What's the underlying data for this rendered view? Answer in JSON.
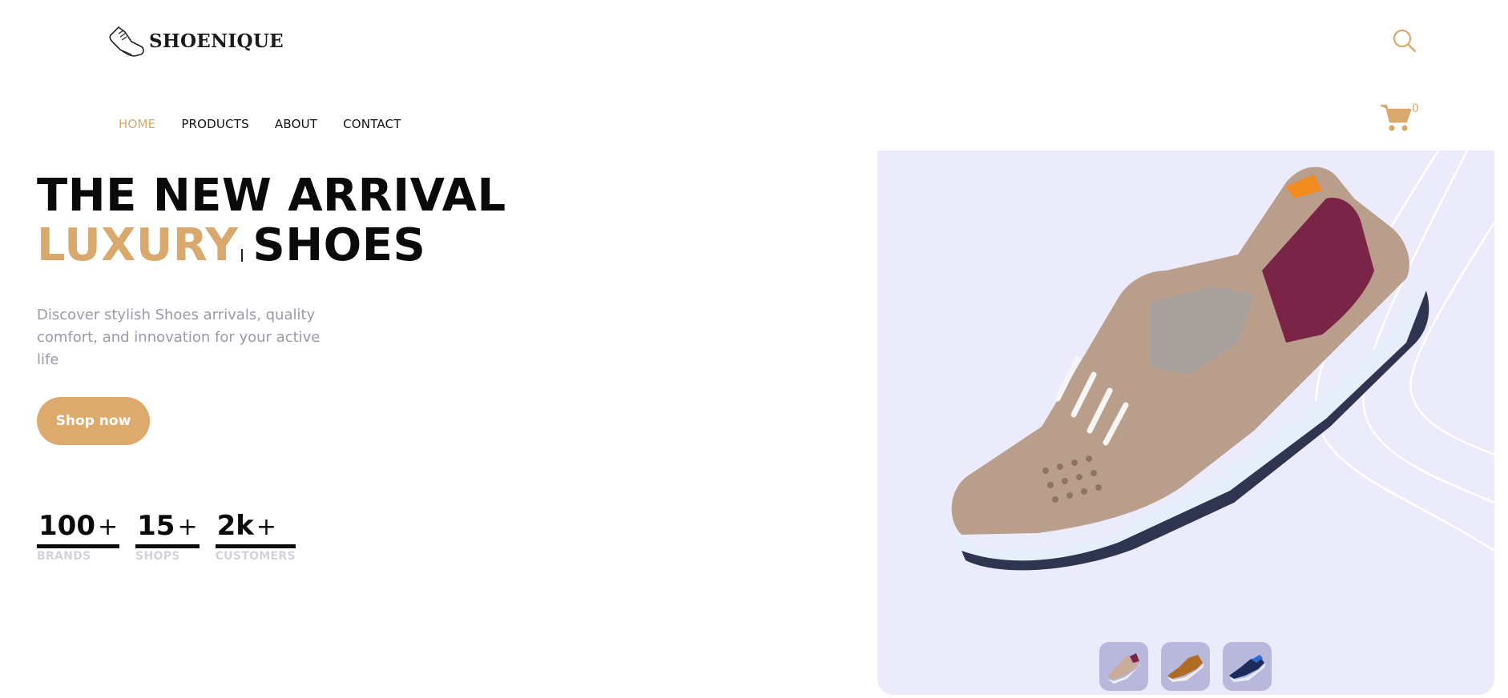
{
  "brand": {
    "name": "SHOENIQUE",
    "logo_icon": "sneaker-outline-icon"
  },
  "header": {
    "search_icon": "search-icon",
    "cart_icon": "cart-icon",
    "cart_count": "0"
  },
  "nav": {
    "items": [
      {
        "label": "HOME",
        "active": true
      },
      {
        "label": "PRODUCTS",
        "active": false
      },
      {
        "label": "ABOUT",
        "active": false
      },
      {
        "label": "CONTACT",
        "active": false
      }
    ]
  },
  "hero": {
    "title_line1": "THE NEW ARRIVAL",
    "title_accent": "LUXURY",
    "title_rest": "SHOES",
    "subtitle": "Discover stylish Shoes arrivals, quality comfort, and innovation for your active life",
    "cta_label": "Shop now"
  },
  "stats": [
    {
      "value": "100",
      "suffix": "+",
      "label": "BRANDS"
    },
    {
      "value": "15",
      "suffix": "+",
      "label": "SHOPS"
    },
    {
      "value": "2k",
      "suffix": "+",
      "label": "CUSTOMERS"
    }
  ],
  "showcase": {
    "thumbnails": [
      {
        "icon": "beige-sneaker-thumbnail-icon"
      },
      {
        "icon": "brown-sneaker-thumbnail-icon"
      },
      {
        "icon": "navy-sneaker-thumbnail-icon"
      }
    ]
  },
  "colors": {
    "accent": "#d9a86c",
    "showcase_bg": "#ebebfb",
    "muted_text": "#9a9aa6",
    "stat_label": "#d2d2da"
  }
}
